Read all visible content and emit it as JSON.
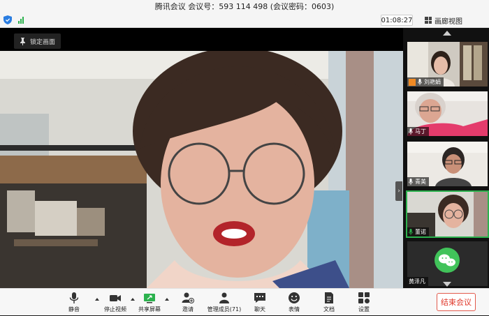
{
  "window": {
    "title": "腾讯会议 会议号：593 114 498  (会议密码：0603)"
  },
  "infobar": {
    "timer": "01:08:27",
    "gallery_label": "画廊视图"
  },
  "main_video": {
    "lock_label": "锁定画面"
  },
  "participants": [
    {
      "name": "刘艳娟",
      "host": true,
      "muted": false
    },
    {
      "name": "马丁",
      "host": false,
      "muted": false
    },
    {
      "name": "青美",
      "host": false,
      "muted": false
    },
    {
      "name": "董诺",
      "host": false,
      "muted": false,
      "speaking": true
    },
    {
      "name": "黄泽凡",
      "host": false,
      "muted": true,
      "avatar": "wechat-icon"
    }
  ],
  "toolbar": {
    "mute": "静音",
    "stop_video": "停止视频",
    "share_screen": "共享屏幕",
    "invite": "邀请",
    "manage_members": "管理成员(71)",
    "chat": "聊天",
    "emoji": "表情",
    "docs": "文档",
    "settings": "设置",
    "end_meeting": "结束会议"
  },
  "colors": {
    "accent_green": "#2cb24e",
    "end_red": "#e0382a",
    "host_orange": "#f08a24"
  }
}
